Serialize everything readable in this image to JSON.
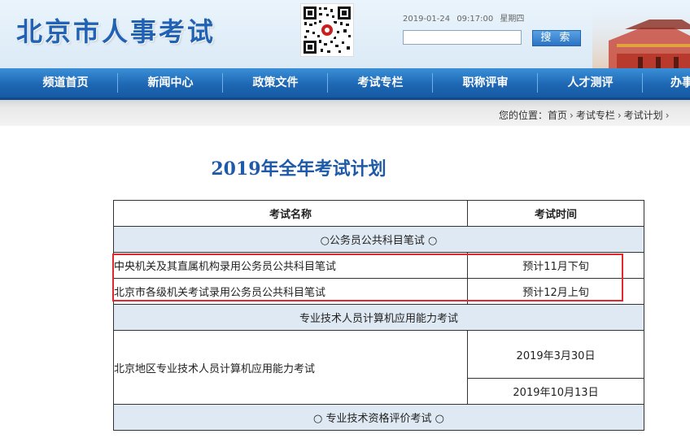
{
  "header": {
    "site_title": "北京市人事考试",
    "date": "2019-01-24",
    "time": "09:17:00",
    "weekday": "星期四",
    "search": {
      "value": "",
      "button_label": "搜 索"
    }
  },
  "nav": {
    "items": [
      {
        "label": "频道首页"
      },
      {
        "label": "新闻中心"
      },
      {
        "label": "政策文件"
      },
      {
        "label": "考试专栏"
      },
      {
        "label": "职称评审"
      },
      {
        "label": "人才测评"
      },
      {
        "label": "办事"
      }
    ]
  },
  "breadcrumb": {
    "prefix": "您的位置：",
    "items": [
      "首页",
      "考试专栏",
      "考试计划"
    ],
    "separator": "›"
  },
  "page_title": "2019年全年考试计划",
  "table": {
    "headers": {
      "name": "考试名称",
      "time": "考试时间"
    },
    "sections": [
      {
        "title": "○公务员公共科目笔试 ○",
        "rows": [
          {
            "name": "中央机关及其直属机构录用公务员公共科目笔试",
            "time": "预计11月下旬"
          },
          {
            "name": "北京市各级机关考试录用公务员公共科目笔试",
            "time": "预计12月上旬"
          }
        ]
      },
      {
        "title": "专业技术人员计算机应用能力考试",
        "rows": [
          {
            "name": "北京地区专业技术人员计算机应用能力考试",
            "times": [
              "2019年3月30日",
              "2019年10月13日"
            ]
          }
        ]
      },
      {
        "title": "○ 专业技术资格评价考试 ○",
        "rows": []
      }
    ]
  },
  "colors": {
    "title_blue": "#2162b4",
    "nav_blue": "#1e67b4",
    "section_bg": "#dfe9f3",
    "highlight_red": "#e0282e"
  }
}
